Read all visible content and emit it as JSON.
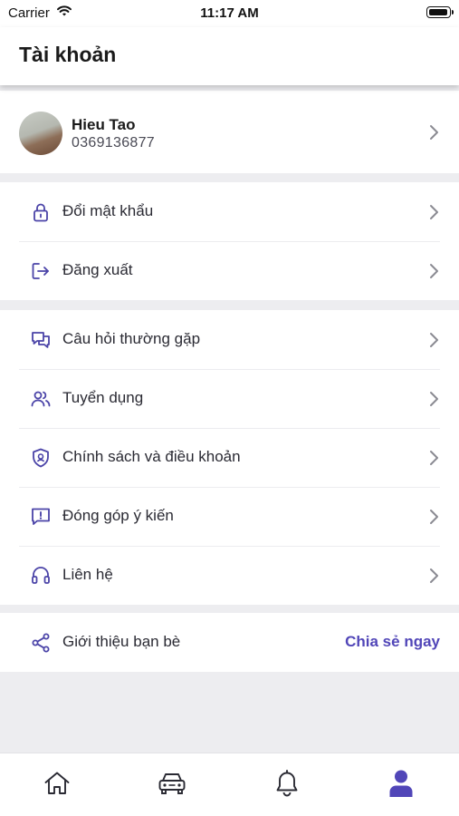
{
  "status_bar": {
    "carrier": "Carrier",
    "time": "11:17 AM"
  },
  "header": {
    "title": "Tài khoản"
  },
  "profile": {
    "name": "Hieu Tao",
    "phone": "0369136877"
  },
  "account_menu": [
    {
      "label": "Đổi mật khẩu",
      "icon": "lock-icon"
    },
    {
      "label": "Đăng xuất",
      "icon": "logout-icon"
    }
  ],
  "info_menu": [
    {
      "label": "Câu hỏi thường gặp",
      "icon": "chat-bubbles-icon"
    },
    {
      "label": "Tuyển dụng",
      "icon": "users-icon"
    },
    {
      "label": "Chính sách và điều khoản",
      "icon": "shield-icon"
    },
    {
      "label": "Đóng góp ý kiến",
      "icon": "feedback-icon"
    },
    {
      "label": "Liên hệ",
      "icon": "headset-icon"
    }
  ],
  "share": {
    "label": "Giới thiệu bạn bè",
    "action": "Chia sẻ ngay",
    "icon": "share-icon"
  },
  "tabbar": [
    {
      "name": "home",
      "icon": "home-icon",
      "active": false
    },
    {
      "name": "car",
      "icon": "car-icon",
      "active": false
    },
    {
      "name": "notifications",
      "icon": "bell-icon",
      "active": false
    },
    {
      "name": "account",
      "icon": "user-icon",
      "active": true
    }
  ],
  "colors": {
    "accent": "#5146b8",
    "icon": "#4b44a8",
    "background": "#ededf0",
    "chevron": "#8a8a92"
  }
}
